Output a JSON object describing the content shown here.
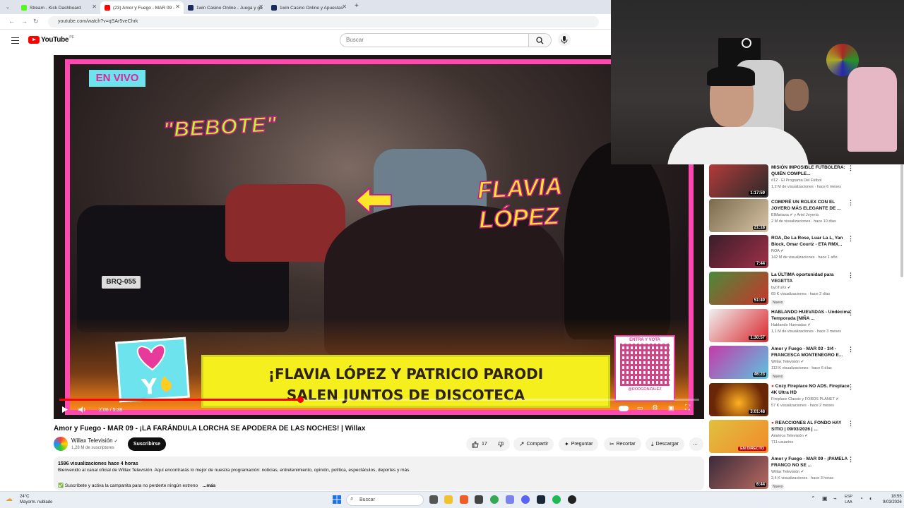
{
  "browser": {
    "tabs": [
      {
        "label": "Stream - Kick Dashboard",
        "fav_color": "#53fc18",
        "active": false
      },
      {
        "label": "(23) Amor y Fuego - MAR 09 -",
        "fav_color": "#ff0000",
        "active": true
      },
      {
        "label": "1win Casino Online - Juega y ga",
        "fav_color": "#1a2a5a",
        "active": false
      },
      {
        "label": "1win Casino Online y Apuestas",
        "fav_color": "#1a2a5a",
        "active": false
      }
    ],
    "new_tab": "+",
    "url": "youtube.com/watch?v=qSAr5veChrk"
  },
  "youtube": {
    "logo_text": "YouTube",
    "logo_country": "PE",
    "search_placeholder": "Buscar"
  },
  "video": {
    "overlay_badge": "EN VIVO",
    "overlay_name1": "\"BEBOTE\"",
    "overlay_name2_line1": "FLAVIA",
    "overlay_name2_line2": "LÓPEZ",
    "lower_third_line1": "¡FLAVIA LÓPEZ Y PATRICIO PARODI",
    "lower_third_line2": "SALEN JUNTOS DE DISCOTECA",
    "qr_title": "ENTRA Y VOTA",
    "qr_handle": "@RODGONZALEZ",
    "time_current": "2:06",
    "time_total": "5:38",
    "progress": 0.376,
    "title": "Amor y Fuego - MAR 09 - ¡LA FARÁNDULA LORCHA SE APODERA DE LAS NOCHES! | Willax",
    "channel": "Willax Televisión",
    "subscribers": "1,28 M de suscriptores",
    "subscribe_label": "Suscribirse",
    "likes": "17",
    "actions": {
      "share": "Compartir",
      "ask": "Preguntar",
      "clip": "Recortar",
      "download": "Descargar"
    },
    "description_stats": "1596 visualizaciones  hace 4 horas",
    "description_line1": "Bienvenido al canal oficial de Willax Televisión. Aquí encontrarás lo mejor de nuestra programación: noticias, entretenimiento, opinión, política, espectáculos, deportes y más.",
    "description_line2": "✅ Suscríbete y activa la campanita para no perderte ningún estreno",
    "description_more": "...más"
  },
  "recommendations": [
    {
      "title": "MISIÓN IMPOSIBLE FUTBOLERA: QUIÉN COMPLE...",
      "channel": "#12 · El Programa Del Fútbol",
      "meta": "1,2 M de visualizaciones · hace 6 meses",
      "duration": "1:17:59",
      "badge": "",
      "thumb": "#b33a3a"
    },
    {
      "title": "COMPRÉ UN ROLEX CON EL JOYERO MÁS ELEGANTE DE ...",
      "channel": "ElMariana ✔ y Ariel Joyería",
      "meta": "2 M de visualizaciones · hace 10 días",
      "duration": "21:18",
      "badge": "",
      "thumb": "#7a6a4a"
    },
    {
      "title": "ROA, De La Rose, Luar La L, Yan Block, Omar Courtz - ETA RMX...",
      "channel": "ROA ✔",
      "meta": "142 M de visualizaciones · hace 1 año",
      "duration": "7:44",
      "badge": "",
      "thumb": "#3a1e2a"
    },
    {
      "title": "La ÚLTIMA oportunidad para VEGETTA",
      "channel": "byoTuXx ✔",
      "meta": "69 K visualizaciones · hace 2 días",
      "duration": "51:40",
      "badge": "Nuevo",
      "thumb": "#c8362a"
    },
    {
      "title": "HABLANDO HUEVADAS - Undécima Temporada [NIÑA ...",
      "channel": "Hablando Huevadas ✔",
      "meta": "1,1 M de visualizaciones · hace 3 meses",
      "duration": "1:30:57",
      "badge": "",
      "thumb": "#d8262b"
    },
    {
      "title": "Amor y Fuego - MAR 03 - 3/4 - FRANCESCA MONTENEGRO E...",
      "channel": "Willax Televisión ✔",
      "meta": "113 K visualizaciones · hace 6 días",
      "duration": "46:23",
      "badge": "Nuevo",
      "thumb": "#c63aa8"
    },
    {
      "title": "Cozy Fireplace NO ADS. Fireplace 4K Ultra HD",
      "channel": "Fireplace Classic y FOBOS PLANET ✔",
      "meta": "57 K visualizaciones · hace 2 meses",
      "duration": "3:01:48",
      "badge": "",
      "thumb": "#6a2608"
    },
    {
      "title": "REACCIONES AL FONDO HAY SITIO | 09/03/2026 | ...",
      "channel": "América Televisión ✔",
      "meta": "711 usuarios",
      "duration": "",
      "badge": "",
      "live": "EN DIRECTO",
      "thumb": "#e0c040"
    },
    {
      "title": "Amor y Fuego - MAR 09 - ¡PAMELA FRANCO NO SE ...",
      "channel": "Willax Televisión ✔",
      "meta": "2,4 K visualizaciones · hace 3 horas",
      "duration": "6:44",
      "badge": "Nuevo",
      "thumb": "#3a2a3a"
    }
  ],
  "taskbar": {
    "temp": "24°C",
    "weather": "Mayorm. nublado",
    "search": "Buscar",
    "lang1": "ESP",
    "lang2": "LAA",
    "time": "18:55",
    "date": "9/03/2026"
  }
}
